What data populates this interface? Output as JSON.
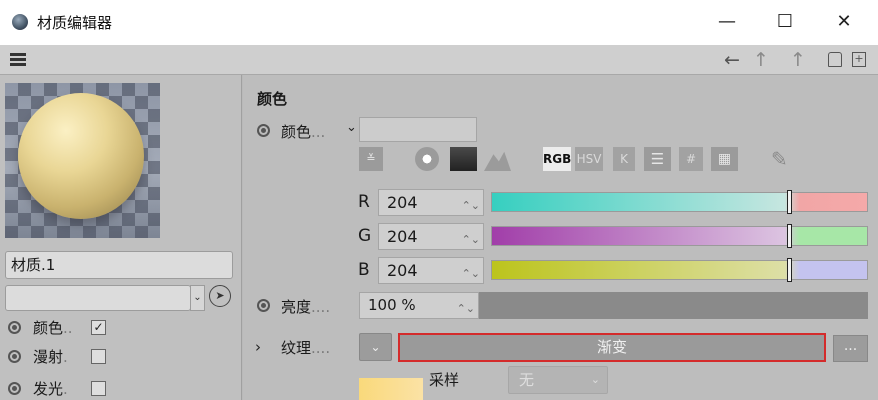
{
  "window": {
    "title": "材质编辑器",
    "minimize": "—",
    "maximize": "☐",
    "close": "✕"
  },
  "toolbar": {
    "back": "←",
    "up": "↑",
    "up2": "↑",
    "lock": "🔓",
    "new": "+"
  },
  "left_panel": {
    "material_name": "材质.1",
    "channels": [
      {
        "label": "颜色",
        "dots": "..",
        "checked": "✓"
      },
      {
        "label": "漫射",
        "dots": ".",
        "checked": ""
      },
      {
        "label": "发光",
        "dots": ".",
        "checked": ""
      }
    ]
  },
  "color_section": {
    "title": "颜色",
    "color_label": "颜色",
    "color_dots": "...",
    "tool_labels": {
      "rgb": "RGB",
      "hsv": "HSV",
      "k": "K",
      "hash": "#"
    },
    "channels": [
      {
        "name": "R",
        "value": "204"
      },
      {
        "name": "G",
        "value": "204"
      },
      {
        "name": "B",
        "value": "204"
      }
    ],
    "brightness_label": "亮度",
    "brightness_dots": "....",
    "brightness_value": "100 %",
    "texture_label": "纹理",
    "texture_dots": "....",
    "texture_button": "渐变",
    "texture_more": "...",
    "sample_label": "采样",
    "sample_value": "无"
  },
  "colors": {
    "highlight_border": "#d42b2b"
  }
}
